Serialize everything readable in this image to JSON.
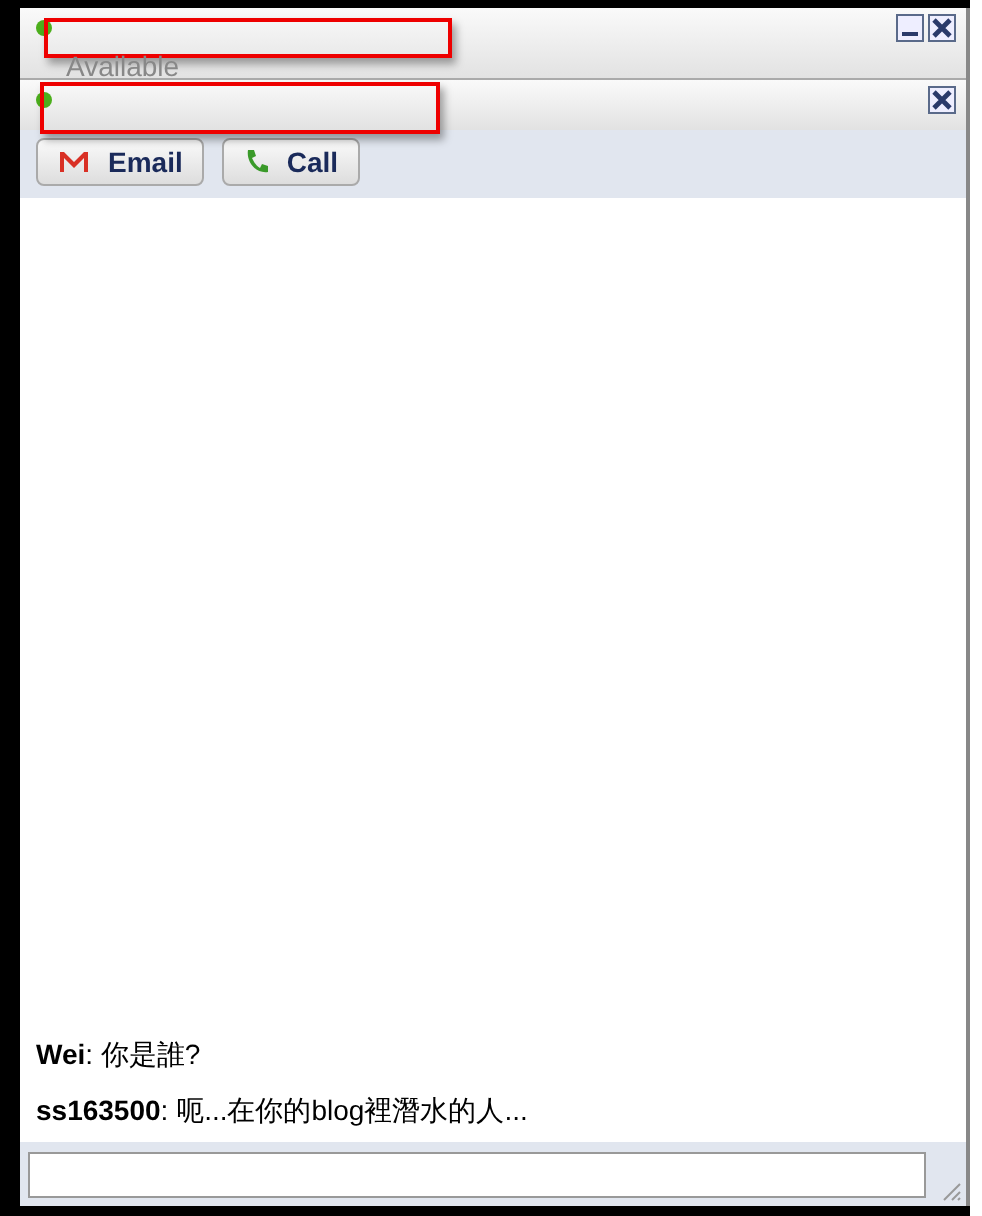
{
  "contact_header": {
    "status": "Available",
    "online": true
  },
  "chat_header": {
    "online": true
  },
  "actions": [
    {
      "kind": "email",
      "label": "Email"
    },
    {
      "kind": "call",
      "label": "Call"
    }
  ],
  "messages": [
    {
      "text": "**Wei**: 你是誰?"
    },
    {
      "text": "**ss163500**: 呃...在你的blog裡潛水的人..."
    }
  ]
}
